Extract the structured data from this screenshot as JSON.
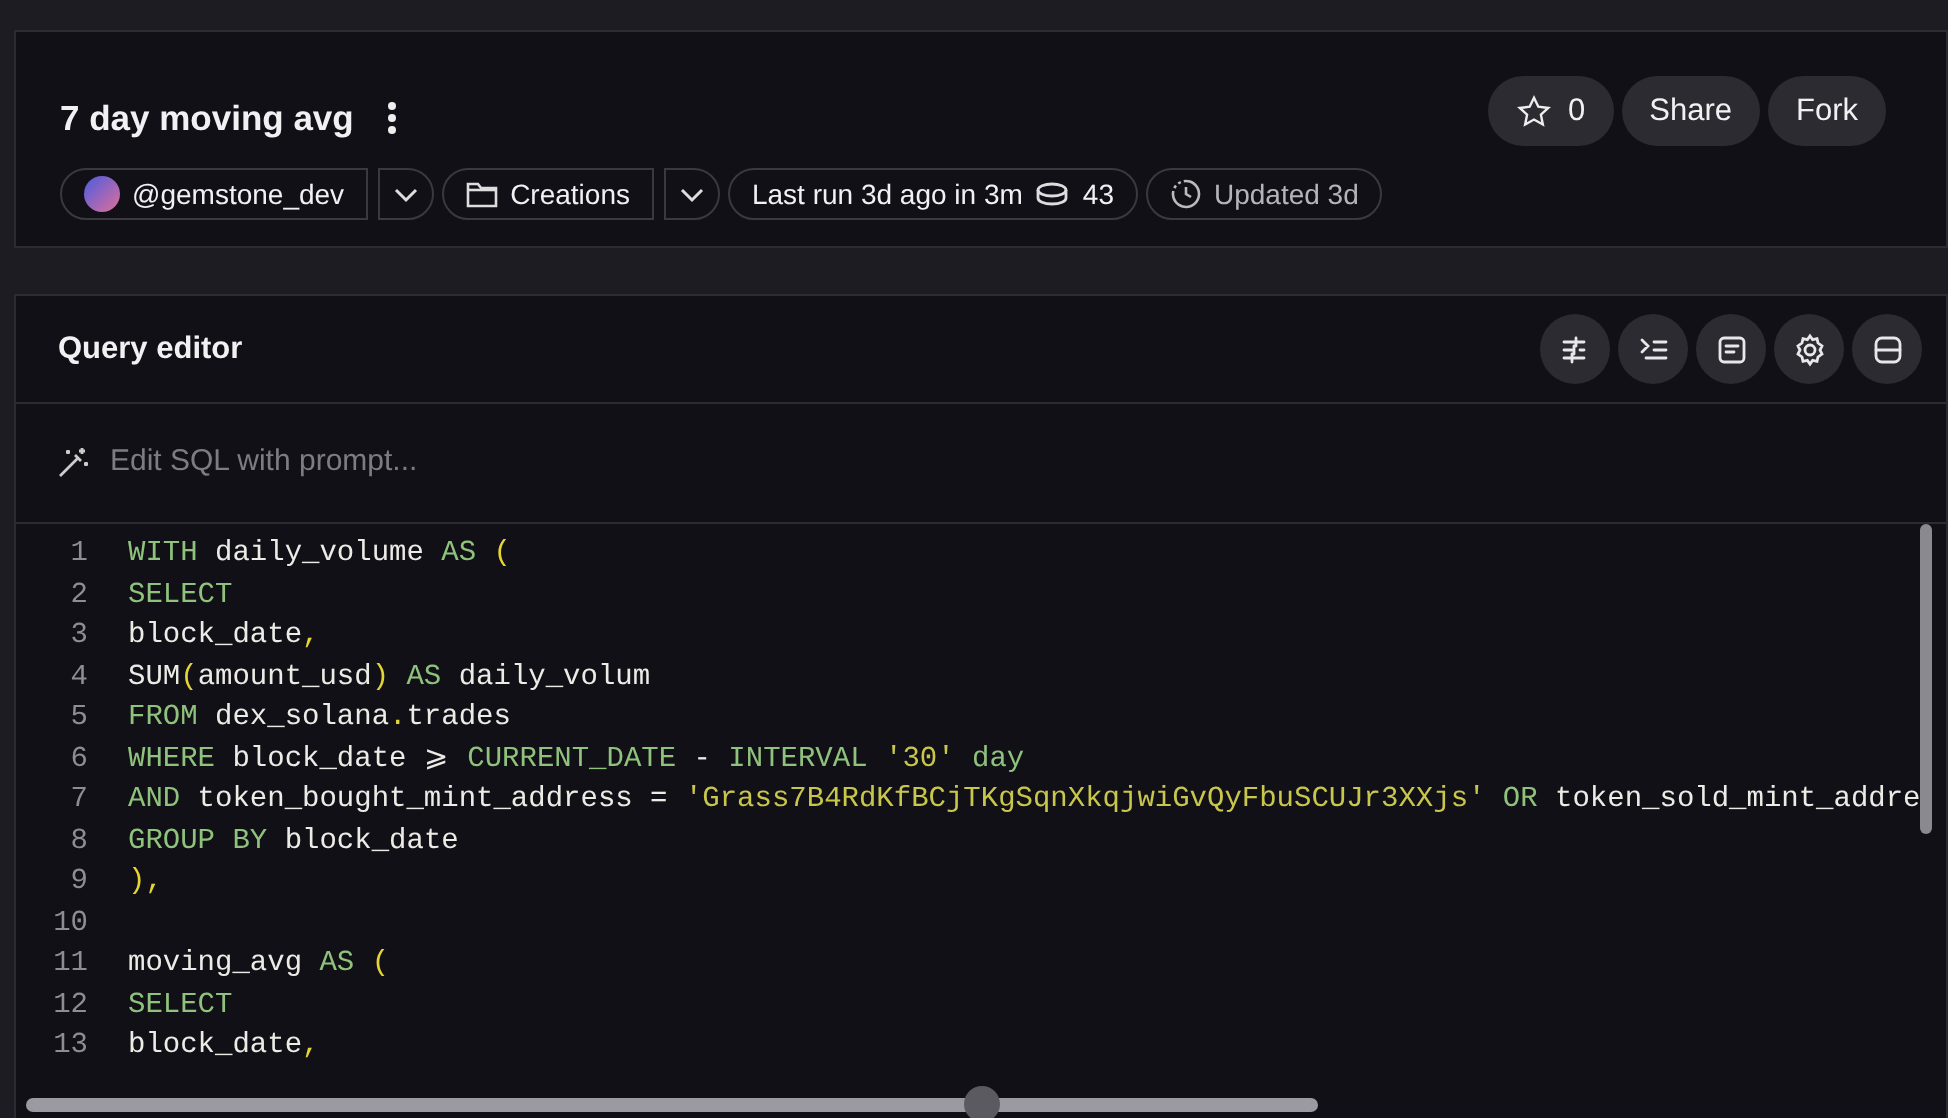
{
  "header": {
    "title": "7 day moving avg",
    "owner": "@gemstone_dev",
    "folder": "Creations",
    "last_run": "Last run 3d ago in 3m",
    "credits": "43",
    "updated": "Updated 3d",
    "stars": "0",
    "buttons": [
      "Share",
      "Fork"
    ]
  },
  "editor": {
    "title": "Query editor",
    "prompt_placeholder": "Edit SQL with prompt...",
    "lines": [
      {
        "n": "1",
        "tokens": [
          {
            "t": "WITH",
            "kind": "kw"
          },
          {
            "t": " daily_volume ",
            "kind": "id"
          },
          {
            "t": "AS",
            "kind": "kw"
          },
          {
            "t": " (",
            "kind": "punct"
          }
        ]
      },
      {
        "n": "2",
        "tokens": [
          {
            "t": "SELECT",
            "kind": "kw"
          }
        ]
      },
      {
        "n": "3",
        "tokens": [
          {
            "t": "block_date",
            "kind": "id"
          },
          {
            "t": ",",
            "kind": "punct"
          }
        ]
      },
      {
        "n": "4",
        "tokens": [
          {
            "t": "SUM",
            "kind": "id"
          },
          {
            "t": "(",
            "kind": "punct"
          },
          {
            "t": "amount_usd",
            "kind": "id"
          },
          {
            "t": ")",
            "kind": "punct"
          },
          {
            "t": " AS",
            "kind": "kw"
          },
          {
            "t": " daily_volum",
            "kind": "id"
          }
        ]
      },
      {
        "n": "5",
        "tokens": [
          {
            "t": "FROM",
            "kind": "kw"
          },
          {
            "t": " dex_solana",
            "kind": "id"
          },
          {
            "t": ".",
            "kind": "punct"
          },
          {
            "t": "trades",
            "kind": "id"
          }
        ]
      },
      {
        "n": "6",
        "tokens": [
          {
            "t": "WHERE",
            "kind": "kw"
          },
          {
            "t": " block_date ",
            "kind": "id"
          },
          {
            "t": "⩾",
            "kind": "id"
          },
          {
            "t": " CURRENT_DATE",
            "kind": "kw"
          },
          {
            "t": " - ",
            "kind": "id"
          },
          {
            "t": "INTERVAL",
            "kind": "kw"
          },
          {
            "t": " '30'",
            "kind": "str"
          },
          {
            "t": " day",
            "kind": "kw"
          }
        ]
      },
      {
        "n": "7",
        "tokens": [
          {
            "t": "AND",
            "kind": "kw"
          },
          {
            "t": " token_bought_mint_address = ",
            "kind": "id"
          },
          {
            "t": "'Grass7B4RdKfBCjTKgSqnXkqjwiGvQyFbuSCUJr3XXjs'",
            "kind": "str"
          },
          {
            "t": " OR",
            "kind": "kw"
          },
          {
            "t": " token_sold_mint_addre",
            "kind": "id"
          }
        ]
      },
      {
        "n": "8",
        "tokens": [
          {
            "t": "GROUP BY",
            "kind": "kw"
          },
          {
            "t": " block_date",
            "kind": "id"
          }
        ]
      },
      {
        "n": "9",
        "tokens": [
          {
            "t": "),",
            "kind": "punct"
          }
        ]
      },
      {
        "n": "10"
      },
      {
        "n": "11",
        "tokens": [
          {
            "t": "moving_avg ",
            "kind": "id"
          },
          {
            "t": "AS",
            "kind": "kw"
          },
          {
            "t": " (",
            "kind": "punct"
          }
        ]
      },
      {
        "n": "12",
        "tokens": [
          {
            "t": "SELECT",
            "kind": "kw"
          }
        ]
      },
      {
        "n": "13",
        "tokens": [
          {
            "t": "block_date",
            "kind": "id"
          },
          {
            "t": ",",
            "kind": "punct"
          }
        ]
      }
    ]
  }
}
